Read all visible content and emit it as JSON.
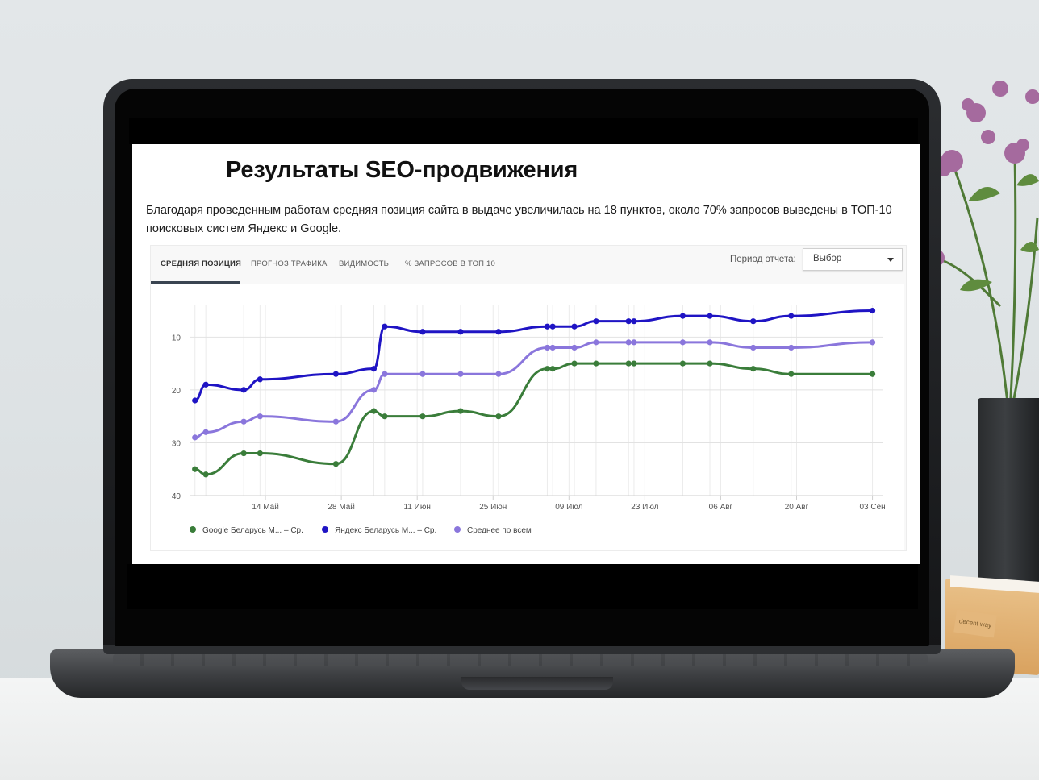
{
  "page": {
    "title": "Результаты SEO-продвижения",
    "description": "Благодаря проведенным работам средняя позиция сайта в выдаче увеличилась на 18 пунктов, около 70% запросов выведены в ТОП-10 поисковых систем Яндекс и Google."
  },
  "widget": {
    "tabs": [
      {
        "label": "СРЕДНЯЯ ПОЗИЦИЯ",
        "active": true
      },
      {
        "label": "ПРОГНОЗ ТРАФИКА",
        "active": false
      },
      {
        "label": "ВИДИМОСТЬ",
        "active": false
      },
      {
        "label": "% ЗАПРОСОВ В ТОП 10",
        "active": false
      }
    ],
    "period_label": "Период отчета:",
    "period_value": "Выбор"
  },
  "book": {
    "label": "decent way"
  },
  "chart_data": {
    "type": "line",
    "y_reversed": true,
    "ylim": [
      40,
      4
    ],
    "y_ticks": [
      10,
      20,
      30,
      40
    ],
    "x_range": [
      "2023-04-30",
      "2023-09-05"
    ],
    "x_ticks": [
      {
        "date": "2023-05-14",
        "label": "14 Май"
      },
      {
        "date": "2023-05-28",
        "label": "28 Май"
      },
      {
        "date": "2023-06-11",
        "label": "11 Июн"
      },
      {
        "date": "2023-06-25",
        "label": "25 Июн"
      },
      {
        "date": "2023-07-09",
        "label": "09 Июл"
      },
      {
        "date": "2023-07-23",
        "label": "23 Июл"
      },
      {
        "date": "2023-08-06",
        "label": "06 Авг"
      },
      {
        "date": "2023-08-20",
        "label": "20 Авг"
      },
      {
        "date": "2023-09-03",
        "label": "03 Сен"
      }
    ],
    "grid": true,
    "legend_position": "bottom-left",
    "x": [
      "2023-05-01",
      "2023-05-03",
      "2023-05-09",
      "2023-05-11",
      "2023-05-28",
      "2023-06-04",
      "2023-06-11",
      "2023-06-18",
      "2023-06-24",
      "2023-07-03",
      "2023-07-04",
      "2023-07-09",
      "2023-07-15",
      "2023-07-21",
      "2023-07-23",
      "2023-07-30",
      "2023-08-04",
      "2023-08-12",
      "2023-08-19",
      "2023-09-04"
    ],
    "series": [
      {
        "name": "Google Беларусь М... – Ср.",
        "color": "#3a7d3a",
        "values": [
          35,
          36,
          32,
          32,
          34,
          24,
          25,
          25,
          24,
          25,
          16,
          16,
          15,
          15,
          15,
          15,
          15,
          15,
          16,
          17,
          17
        ]
      },
      {
        "name": "Яндекс Беларусь М... – Ср.",
        "color": "#1f14c4",
        "values": [
          22,
          19,
          20,
          18,
          17,
          16,
          8,
          9,
          9,
          9,
          8,
          8,
          8,
          7,
          7,
          7,
          6,
          6,
          7,
          6,
          5
        ]
      },
      {
        "name": "Среднее по всем",
        "color": "#8a76dc",
        "values": [
          29,
          28,
          26,
          25,
          26,
          20,
          17,
          17,
          17,
          17,
          12,
          12,
          12,
          11,
          11,
          11,
          11,
          11,
          12,
          12,
          11
        ]
      }
    ],
    "dates": [
      "2023-05-01",
      "2023-05-03",
      "2023-05-10",
      "2023-05-13",
      "2023-05-27",
      "2023-06-03",
      "2023-06-05",
      "2023-06-12",
      "2023-06-19",
      "2023-06-26",
      "2023-07-05",
      "2023-07-06",
      "2023-07-10",
      "2023-07-14",
      "2023-07-20",
      "2023-07-21",
      "2023-07-30",
      "2023-08-04",
      "2023-08-12",
      "2023-08-19",
      "2023-09-03"
    ]
  }
}
